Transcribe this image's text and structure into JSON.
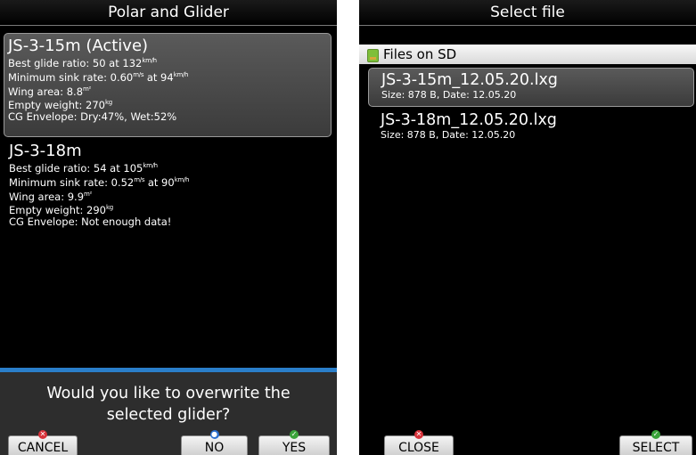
{
  "left": {
    "title": "Polar and Glider",
    "gliders": [
      {
        "name": "JS-3-15m (Active)",
        "best_glide": "Best glide ratio: 50 at 132",
        "min_sink": "Minimum sink rate: 0.60",
        "min_sink_at": " at 94",
        "wing_area": "Wing area: 8.8",
        "empty_weight": "Empty weight: 270",
        "cg": "CG Envelope: Dry:47%, Wet:52%"
      },
      {
        "name": "JS-3-18m",
        "best_glide": "Best glide ratio: 54 at 105",
        "min_sink": "Minimum sink rate: 0.52",
        "min_sink_at": " at 90",
        "wing_area": "Wing area: 9.9",
        "empty_weight": "Empty weight: 290",
        "cg": "CG Envelope: Not enough data!"
      }
    ],
    "units": {
      "speed": "km/h",
      "sink": "m/s",
      "area": "m²",
      "weight": "kg"
    },
    "dialog": {
      "question": "Would you like to overwrite the selected glider?",
      "buttons": {
        "cancel": "CANCEL",
        "no": "NO",
        "yes": "YES"
      }
    }
  },
  "right": {
    "title": "Select file",
    "section": "Files on SD",
    "files": [
      {
        "name": "JS-3-15m_12.05.20.lxg",
        "meta": "Size: 878 B, Date: 12.05.20"
      },
      {
        "name": "JS-3-18m_12.05.20.lxg",
        "meta": "Size: 878 B, Date: 12.05.20"
      }
    ],
    "buttons": {
      "close": "CLOSE",
      "select": "SELECT"
    }
  },
  "colors": {
    "accent": "#2a7ec9",
    "cancel_mark": "#d8323a",
    "ok_mark": "#3aa33a",
    "no_mark": "#2a6fd0"
  }
}
